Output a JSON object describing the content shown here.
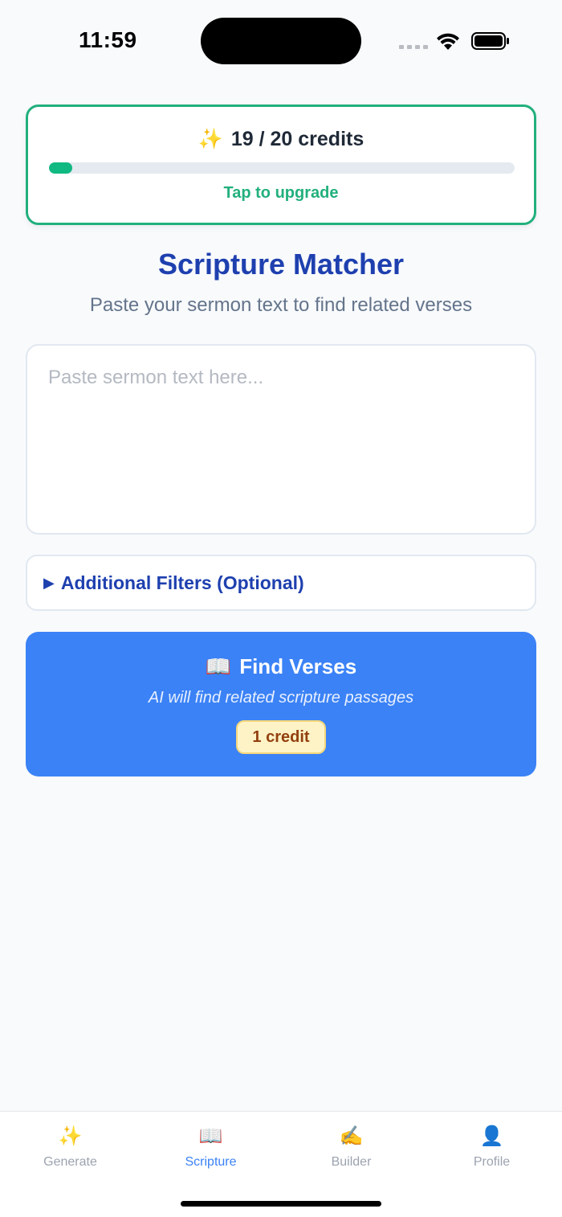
{
  "status_bar": {
    "time": "11:59"
  },
  "credits": {
    "spark_icon": "✨",
    "label": "19 / 20 credits",
    "used_fraction": 0.05,
    "upgrade_label": "Tap to upgrade"
  },
  "header": {
    "title": "Scripture Matcher",
    "subtitle": "Paste your sermon text to find related verses"
  },
  "sermon_input": {
    "placeholder": "Paste sermon text here...",
    "value": ""
  },
  "filters": {
    "caret": "▶",
    "label": "Additional Filters (Optional)"
  },
  "find_button": {
    "icon": "📖",
    "label": "Find Verses",
    "description": "AI will find related scripture passages",
    "cost_label": "1 credit"
  },
  "tab_bar": {
    "tabs": [
      {
        "icon": "✨",
        "label": "Generate",
        "active": false
      },
      {
        "icon": "📖",
        "label": "Scripture",
        "active": true
      },
      {
        "icon": "✍️",
        "label": "Builder",
        "active": false
      },
      {
        "icon": "👤",
        "label": "Profile",
        "active": false
      }
    ]
  },
  "colors": {
    "accent": "#3b82f6",
    "title_blue": "#1e40af",
    "credit_green": "#22b07d",
    "badge_bg": "#fef3c7",
    "badge_text": "#92400e"
  }
}
